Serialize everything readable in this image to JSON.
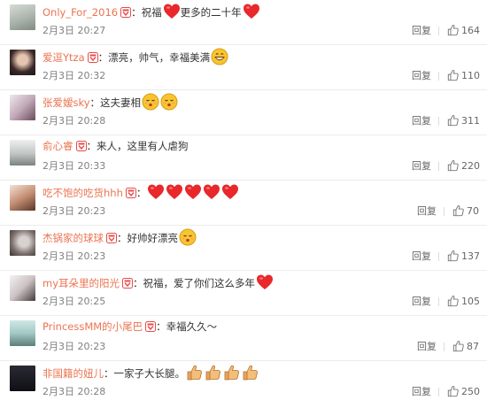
{
  "comments": [
    {
      "username": "Only_For_2016",
      "text_parts": [
        "：祝福",
        "更多的二十年"
      ],
      "timestamp": "2月3日 20:27",
      "reply_label": "回复",
      "likes": "164"
    },
    {
      "username": "爱逗Ytza",
      "text_parts": [
        "：漂亮，帅气，幸福美满"
      ],
      "timestamp": "2月3日 20:32",
      "reply_label": "回复",
      "likes": "110"
    },
    {
      "username": "张爱嫒sky",
      "text_parts": [
        "：这夫妻相"
      ],
      "timestamp": "2月3日 20:28",
      "reply_label": "回复",
      "likes": "311"
    },
    {
      "username": "俞心睿",
      "text_parts": [
        "：来人，这里有人虐狗"
      ],
      "timestamp": "2月3日 20:33",
      "reply_label": "回复",
      "likes": "220"
    },
    {
      "username": "吃不饱的吃货hhh",
      "text_parts": [
        "："
      ],
      "timestamp": "2月3日 20:23",
      "reply_label": "回复",
      "likes": "70"
    },
    {
      "username": "杰锅家的球球",
      "text_parts": [
        "：好帅好漂亮"
      ],
      "timestamp": "2月3日 20:23",
      "reply_label": "回复",
      "likes": "137"
    },
    {
      "username": "my耳朵里的阳光",
      "text_parts": [
        "：祝福，爱了你们这么多年"
      ],
      "timestamp": "2月3日 20:25",
      "reply_label": "回复",
      "likes": "105"
    },
    {
      "username": "PrincessMM的小尾巴",
      "text_parts": [
        "：幸福久久～"
      ],
      "timestamp": "2月3日 20:23",
      "reply_label": "回复",
      "likes": "87"
    },
    {
      "username": "非国籍的妞儿",
      "text_parts": [
        "：一家子大长腿。"
      ],
      "timestamp": "2月3日 20:28",
      "reply_label": "回复",
      "likes": "250"
    }
  ],
  "icons": {
    "vip_badge": "vip-badge-icon",
    "heart": "heart-emoji-icon",
    "grin": "grin-emoji-icon",
    "kiss": "kiss-emoji-icon",
    "thumbs_up": "thumbs-up-emoji-icon",
    "like": "like-icon"
  },
  "colors": {
    "username": "#eb7350",
    "heart": "#e8282b",
    "badge": "#e94b4b",
    "timestamp": "#808080",
    "divider": "#ececec"
  }
}
